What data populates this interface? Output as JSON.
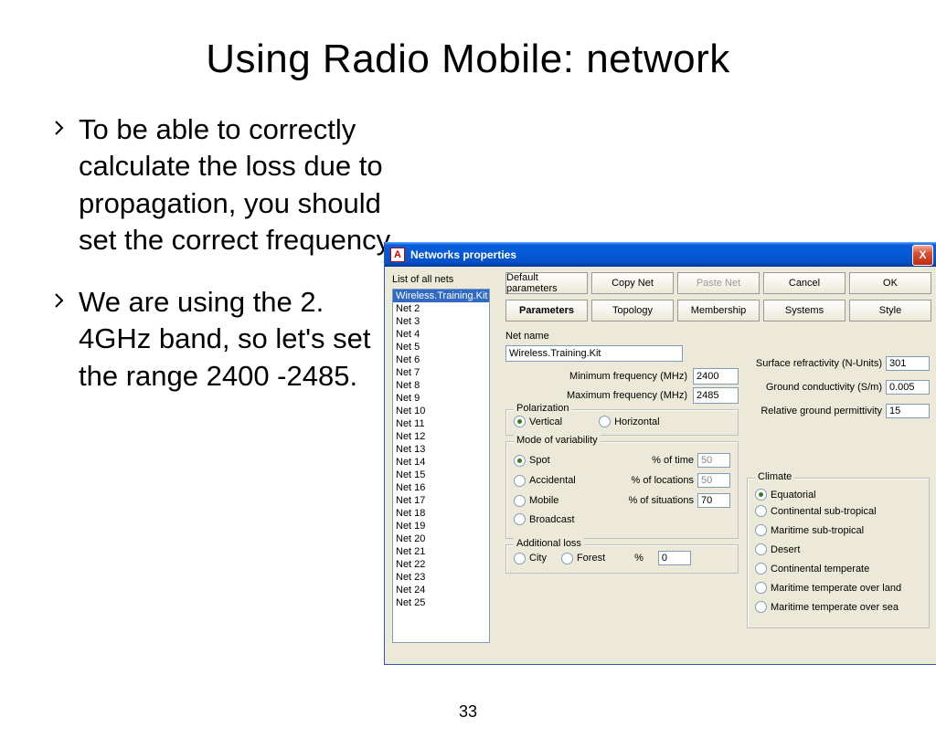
{
  "slide": {
    "title": "Using Radio Mobile: network",
    "bullets": [
      "To be able to correctly calculate the loss due to propagation, you should set the correct frequency.",
      "We are using the 2. 4GHz band, so let's set the range 2400 -2485."
    ],
    "pagenum": "33"
  },
  "window": {
    "title": "Networks properties",
    "close_x": "X",
    "list_label": "List of all nets",
    "nets": [
      "Wireless.Training.Kit",
      "Net  2",
      "Net  3",
      "Net  4",
      "Net  5",
      "Net  6",
      "Net  7",
      "Net  8",
      "Net  9",
      "Net 10",
      "Net 11",
      "Net 12",
      "Net 13",
      "Net 14",
      "Net 15",
      "Net 16",
      "Net 17",
      "Net 18",
      "Net 19",
      "Net 20",
      "Net 21",
      "Net 22",
      "Net 23",
      "Net 24",
      "Net 25"
    ],
    "buttons": {
      "default": "Default parameters",
      "copy": "Copy Net",
      "paste": "Paste Net",
      "cancel": "Cancel",
      "ok": "OK"
    },
    "tabs": {
      "parameters": "Parameters",
      "topology": "Topology",
      "membership": "Membership",
      "systems": "Systems",
      "style": "Style"
    },
    "netname_lbl": "Net name",
    "netname_val": "Wireless.Training.Kit",
    "minfreq_lbl": "Minimum frequency (MHz)",
    "minfreq_val": "2400",
    "maxfreq_lbl": "Maximum frequency (MHz)",
    "maxfreq_val": "2485",
    "polarization": {
      "title": "Polarization",
      "vertical": "Vertical",
      "horizontal": "Horizontal"
    },
    "variability": {
      "title": "Mode of variability",
      "spot": "Spot",
      "accidental": "Accidental",
      "mobile": "Mobile",
      "broadcast": "Broadcast",
      "time_lbl": "% of time",
      "time_val": "50",
      "loc_lbl": "% of locations",
      "loc_val": "50",
      "sit_lbl": "% of situations",
      "sit_val": "70"
    },
    "addloss": {
      "title": "Additional loss",
      "city": "City",
      "forest": "Forest",
      "pct": "%",
      "val": "0"
    },
    "right": {
      "refrac_lbl": "Surface refractivity (N-Units)",
      "refrac_val": "301",
      "ground_lbl": "Ground conductivity (S/m)",
      "ground_val": "0.005",
      "perm_lbl": "Relative ground permittivity",
      "perm_val": "15"
    },
    "climate": {
      "title": "Climate",
      "opts": [
        "Equatorial",
        "Continental sub-tropical",
        "Maritime sub-tropical",
        "Desert",
        "Continental temperate",
        "Maritime temperate over land",
        "Maritime temperate over sea"
      ]
    }
  }
}
